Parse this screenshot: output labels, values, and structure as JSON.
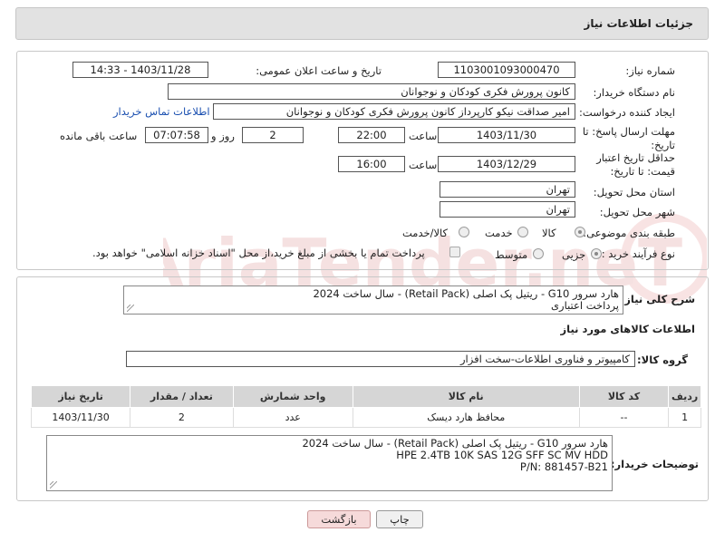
{
  "header": {
    "title": "جزئیات اطلاعات نیاز"
  },
  "fields": {
    "need_number_label": "شماره نیاز:",
    "need_number": "1103001093000470",
    "announce_label": "تاریخ و ساعت اعلان عمومی:",
    "announce_value": "1403/11/28 - 14:33",
    "buyer_org_label": "نام دستگاه خریدار:",
    "buyer_org": "کانون پرورش فکری کودکان و نوجوانان",
    "creator_label": "ایجاد کننده درخواست:",
    "creator": "امیر صداقت نیکو کارپرداز کانون پرورش فکری کودکان و نوجوانان",
    "contact_link": "اطلاعات تماس خریدار",
    "deadline_label": "مهلت ارسال پاسخ: تا تاریخ:",
    "deadline_date": "1403/11/30",
    "time_label": "ساعت",
    "deadline_time": "22:00",
    "days_value": "2",
    "days_label": "روز و",
    "remaining_time": "07:07:58",
    "remaining_label": "ساعت باقی مانده",
    "validity_label": "حداقل تاریخ اعتبار قیمت: تا تاریخ:",
    "validity_date": "1403/12/29",
    "validity_time": "16:00",
    "province_label": "استان محل تحویل:",
    "province": "تهران",
    "city_label": "شهر محل تحویل:",
    "city": "تهران",
    "category_label": "طبقه بندی موضوعی:",
    "category_options": [
      "کالا",
      "خدمت",
      "کالا/خدمت"
    ],
    "process_label": "نوع فرآیند خرید :",
    "process_options": [
      "جزیی",
      "متوسط"
    ],
    "payment_note": "پرداخت تمام یا بخشی از مبلغ خرید،از محل \"اسناد خزانه اسلامی\" خواهد بود."
  },
  "description": {
    "label": "شرح کلی نیاز:",
    "line1": "هارد سرور G10 - ریتیل پک اصلی (Retail Pack) - سال ساخت 2024",
    "line2": "پرداخت اعتباری"
  },
  "goods": {
    "section_title": "اطلاعات کالاهای مورد نیاز",
    "group_label": "گروه کالا:",
    "group_value": "کامپیوتر و فناوری اطلاعات-سخت افزار",
    "columns": [
      "ردیف",
      "کد کالا",
      "نام کالا",
      "واحد شمارش",
      "تعداد / مقدار",
      "تاریخ نیاز"
    ],
    "rows": [
      {
        "row": "1",
        "code": "--",
        "name": "محافظ هارد دیسک",
        "unit": "عدد",
        "qty": "2",
        "date": "1403/11/30"
      }
    ]
  },
  "buyer_notes": {
    "label": "توضیحات خریدار:",
    "line1": "هارد سرور G10 - ریتیل پک اصلی (Retail Pack) - سال ساخت 2024",
    "line2": "HPE 2.4TB 10K SAS 12G SFF SC MV HDD",
    "line3": "P/N: 881457-B21"
  },
  "buttons": {
    "print": "چاپ",
    "back": "بازگشت"
  },
  "watermark": {
    "text": "AriaTender.neT"
  },
  "colors": {
    "link": "#1a4fb0",
    "header_bg": "#e2e2e2",
    "back_button_bg": "#f6dada",
    "table_header_bg": "#d6d6d6"
  }
}
